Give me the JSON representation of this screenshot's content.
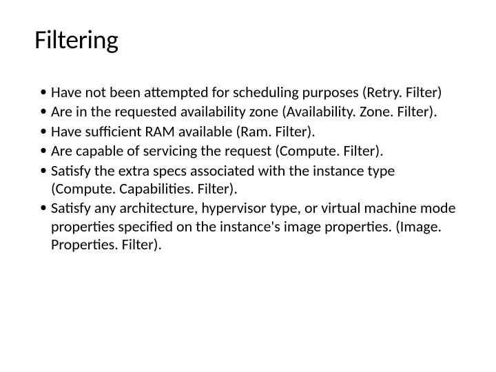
{
  "title": "Filtering",
  "bullets": [
    "Have not been attempted for scheduling purposes (Retry. Filter)",
    "Are in the requested availability zone (Availability. Zone. Filter).",
    "Have sufficient RAM available (Ram. Filter).",
    "Are capable of servicing the request (Compute. Filter).",
    "Satisfy the extra specs associated with the instance type (Compute. Capabilities. Filter).",
    "Satisfy any architecture, hypervisor type, or virtual machine mode properties specified on the instance's image properties. (Image. Properties. Filter)."
  ]
}
